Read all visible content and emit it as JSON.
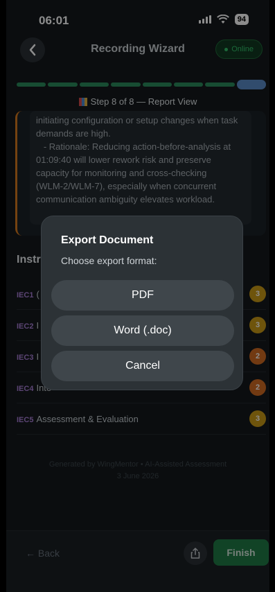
{
  "status_bar": {
    "time": "06:01",
    "battery": "94"
  },
  "header": {
    "title": "Recording Wizard",
    "online_label": "Online"
  },
  "progress": {
    "current_step": 8,
    "total_steps": 8,
    "step_label": "Step 8 of 8 — Report View"
  },
  "card": {
    "lines": [
      "initiating configuration or setup changes when task",
      "demands are high.",
      "   - Rationale: Reducing action-before-analysis at",
      "01:09:40 will lower rework risk and preserve",
      "capacity for monitoring and cross-checking",
      "(WLM-2/WLM-7), especially when concurrent",
      "communication ambiguity elevates workload."
    ]
  },
  "section": {
    "title": "Instr"
  },
  "iec_rows": [
    {
      "code": "IEC1",
      "text": "(",
      "badge": "3",
      "badge_color": "#c99a17"
    },
    {
      "code": "IEC2",
      "text": "I",
      "badge": "3",
      "badge_color": "#c99a17"
    },
    {
      "code": "IEC3",
      "text": "I",
      "badge": "2",
      "badge_color": "#cf6a22"
    },
    {
      "code": "IEC4",
      "text": "Inte",
      "badge": "2",
      "badge_color": "#cf6a22"
    },
    {
      "code": "IEC5",
      "text": "Assessment & Evaluation",
      "badge": "3",
      "badge_color": "#c99a17"
    }
  ],
  "footer": {
    "line1": "Generated by WingMentor • AI-Assisted Assessment",
    "line2": "3 June 2026"
  },
  "bottom_bar": {
    "back_label": "← Back",
    "finish_label": "Finish"
  },
  "dialog": {
    "title": "Export Document",
    "subtitle": "Choose export format:",
    "options": [
      "PDF",
      "Word (.doc)",
      "Cancel"
    ]
  },
  "colors": {
    "accent_green": "#1f7a45",
    "progress_done": "#2b8a5b",
    "progress_current": "#5a8bc7",
    "card_border": "#d5791e"
  }
}
